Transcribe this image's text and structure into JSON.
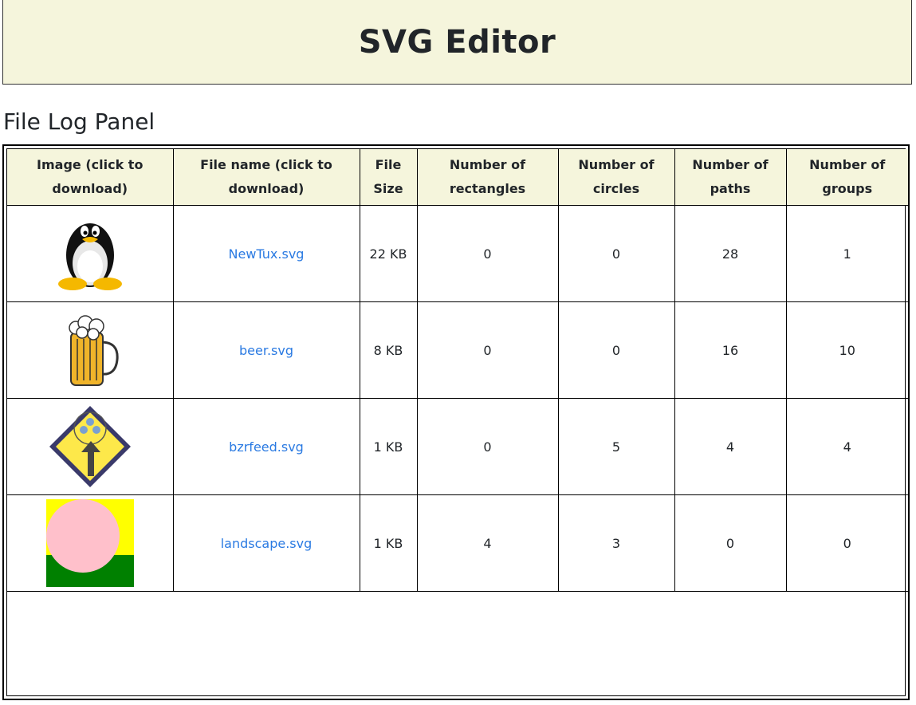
{
  "header": {
    "title": "SVG Editor"
  },
  "panel": {
    "title": "File Log Panel"
  },
  "table": {
    "columns": [
      "Image (click to download)",
      "File name (click to download)",
      "File Size",
      "Number of rectangles",
      "Number of circles",
      "Number of paths",
      "Number of groups"
    ],
    "rows": [
      {
        "image_icon": "penguin-icon",
        "file_name": "NewTux.svg",
        "file_size": "22 KB",
        "rectangles": "0",
        "circles": "0",
        "paths": "28",
        "groups": "1"
      },
      {
        "image_icon": "beer-mug-icon",
        "file_name": "beer.svg",
        "file_size": "8 KB",
        "rectangles": "0",
        "circles": "0",
        "paths": "16",
        "groups": "10"
      },
      {
        "image_icon": "merge-sign-icon",
        "file_name": "bzrfeed.svg",
        "file_size": "1 KB",
        "rectangles": "0",
        "circles": "5",
        "paths": "4",
        "groups": "4"
      },
      {
        "image_icon": "landscape-image",
        "file_name": "landscape.svg",
        "file_size": "1 KB",
        "rectangles": "4",
        "circles": "3",
        "paths": "0",
        "groups": "0"
      }
    ]
  },
  "colors": {
    "header_bg": "#f5f5dc",
    "link": "#2a7ae2"
  }
}
